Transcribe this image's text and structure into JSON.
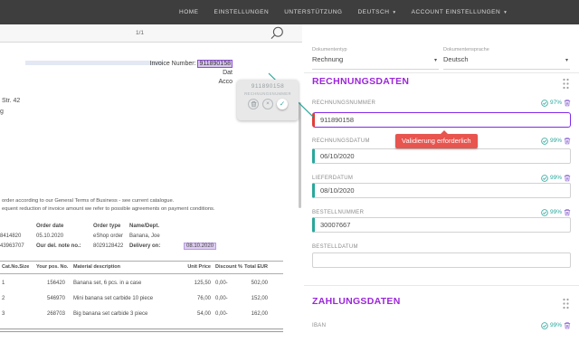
{
  "nav": {
    "items": [
      {
        "label": "HOME"
      },
      {
        "label": "EINSTELLUNGEN"
      },
      {
        "label": "UNTERSTÜTZUNG"
      },
      {
        "label": "DEUTSCH"
      },
      {
        "label": "ACCOUNT EINSTELLUNGEN"
      }
    ]
  },
  "icons": {
    "caret_down": "▾",
    "close": "×",
    "check": "✓"
  },
  "toolbar": {
    "page_indicator": "1/1"
  },
  "document": {
    "invoice_label": "Invoice Number:",
    "invoice_value": "911890158",
    "partial_date_line": "Dat",
    "partial_account_line": "Acco",
    "address_fragment_1": "Str. 42",
    "address_fragment_2": "g",
    "terms_line_1": "order according to our General Terms of Business - see current catalogue.",
    "terms_line_2": "equent reduction of invoice amount we refer to possible agreements on payment conditions.",
    "order_info": {
      "header_order_date": "Order date",
      "header_order_type": "Order type",
      "header_name_dept": "Name/Dept.",
      "row1": {
        "c0": "8414820",
        "c1": "05.10.2020",
        "c2": "eShop order",
        "c3": "Banana, Joe"
      },
      "row2": {
        "c0": "43963707",
        "c1": "Our del. note no.:",
        "c2": "8029128422",
        "c3": "Delivery on:",
        "c4": "08.10.2020"
      }
    },
    "items_table": {
      "headers": [
        "Cat.No.Size",
        "Your pos. No.",
        "Material description",
        "Unit Price",
        "Discount %",
        "Total EUR"
      ],
      "rows": [
        [
          "1",
          "156420",
          "Banana set, 6 pcs. in a case",
          "125,50",
          "0,00-",
          "502,00"
        ],
        [
          "2",
          "546970",
          "Mini banana set carbide 10 piece",
          "76,00",
          "0,00-",
          "152,00"
        ],
        [
          "3",
          "268703",
          "Big banana set carbide 3 piece",
          "54,00",
          "0,00-",
          "162,00"
        ]
      ]
    },
    "selection_popup": {
      "value": "911890158",
      "label": "RECHNUNGSNUMMER"
    }
  },
  "panel": {
    "doc_type": {
      "label": "Dokumententyp",
      "value": "Rechnung"
    },
    "doc_lang": {
      "label": "Dokumentensprache",
      "value": "Deutsch"
    },
    "validation_tooltip": "Validierung erforderlich",
    "sections": [
      {
        "title": "RECHNUNGSDATEN",
        "fields": [
          {
            "label": "RECHNUNGSNUMMER",
            "value": "911890158",
            "confidence": "97%"
          },
          {
            "label": "RECHNUNGSDATUM",
            "value": "06/10/2020",
            "confidence": "99%"
          },
          {
            "label": "LIEFERDATUM",
            "value": "08/10/2020",
            "confidence": "99%"
          },
          {
            "label": "BESTELLNUMMER",
            "value": "30007667",
            "confidence": "99%"
          },
          {
            "label": "BESTELLDATUM",
            "value": "",
            "confidence": ""
          }
        ]
      },
      {
        "title": "ZAHLUNGSDATEN",
        "fields": [
          {
            "label": "IBAN",
            "value": "",
            "confidence": "99%"
          }
        ]
      }
    ]
  },
  "colors": {
    "accent_purple": "#9c27d9",
    "accent_teal": "#2aa79b",
    "error_red": "#e8544e",
    "nav_bg": "#3e3e3e"
  }
}
